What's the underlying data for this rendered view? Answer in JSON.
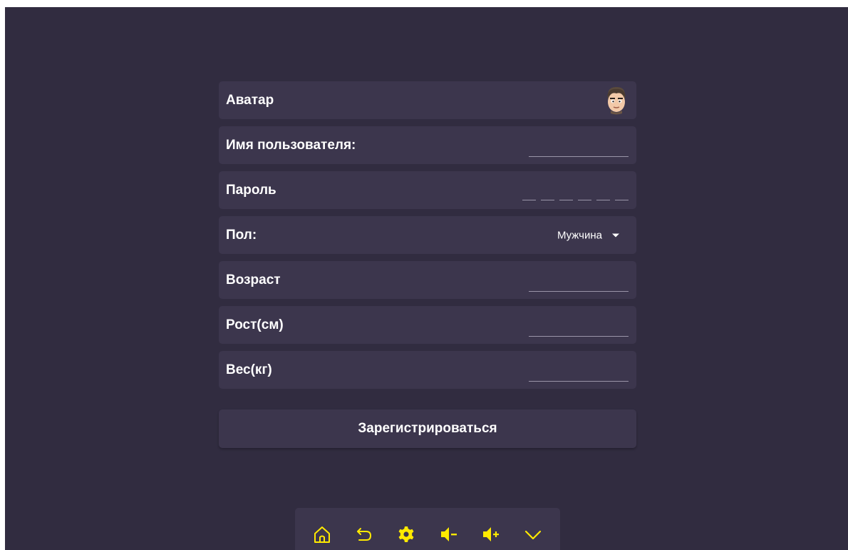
{
  "form": {
    "avatar_label": "Аватар",
    "username_label": "Имя пользователя:",
    "username_value": "",
    "password_label": "Пароль",
    "password_value": "",
    "gender_label": "Пол:",
    "gender_value": "Мужчина",
    "age_label": "Возраст",
    "age_value": "",
    "height_label": "Рост(см)",
    "height_value": "",
    "weight_label": "Вес(кг)",
    "weight_value": "",
    "submit_label": "Зарегистрироваться"
  },
  "navbar": {
    "items": [
      {
        "icon": "home-icon"
      },
      {
        "icon": "back-icon"
      },
      {
        "icon": "gear-icon"
      },
      {
        "icon": "volume-down-icon"
      },
      {
        "icon": "volume-up-icon"
      },
      {
        "icon": "chevron-down-icon"
      }
    ]
  },
  "colors": {
    "background": "#312c40",
    "row": "#3c364d",
    "accent": "#ffea00",
    "text": "#ffffff"
  }
}
